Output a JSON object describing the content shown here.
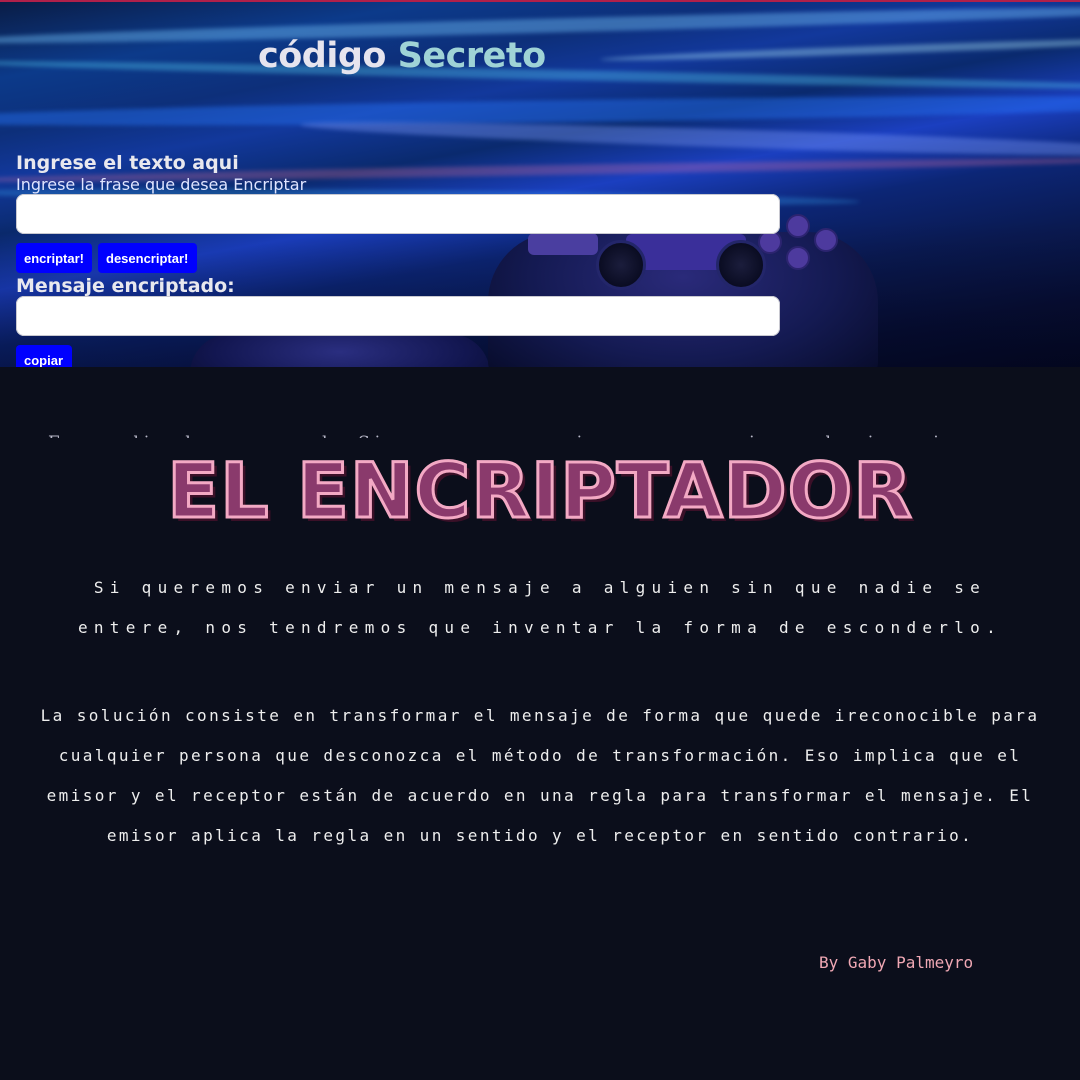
{
  "header": {
    "title_word1": "código",
    "title_word2": "Secreto"
  },
  "form": {
    "input_heading": "Ingrese el texto aqui",
    "input_subtitle": "Ingrese la frase que desea Encriptar",
    "input_value": "",
    "encrypt_label": "encriptar!",
    "decrypt_label": "desencriptar!",
    "output_heading": "Mensaje encriptado:",
    "output_value": "",
    "copy_label": "copiar"
  },
  "info": {
    "ghost_text": "En medio de un mundo Si queremos enviar un mensaje a alguien sin que nadie se entere, nos tendremos que inventar",
    "title": "EL ENCRIPTADOR",
    "paragraph1": "Si queremos enviar un mensaje a alguien sin que nadie se entere, nos tendremos que inventar la forma de esconderlo.",
    "paragraph2": "La solución consiste en transformar el mensaje de forma que quede ireconocible para cualquier persona que desconozca el método de transformación. Eso implica que el emisor y el receptor están de acuerdo en una regla para transformar el mensaje. El emisor aplica la regla en un sentido y el receptor en sentido contrario.",
    "byline": "By Gaby Palmeyro"
  },
  "colors": {
    "button_blue": "#0000ff",
    "title_accent": "#9fd3d6",
    "heading_pink_fill": "#8a3a6c",
    "heading_pink_outline": "#f3a9c4",
    "byline_pink": "#f0a8b4",
    "panel_bg": "#0b0e1b"
  },
  "icons": {
    "hero_image": "gamepad-controller-image"
  }
}
